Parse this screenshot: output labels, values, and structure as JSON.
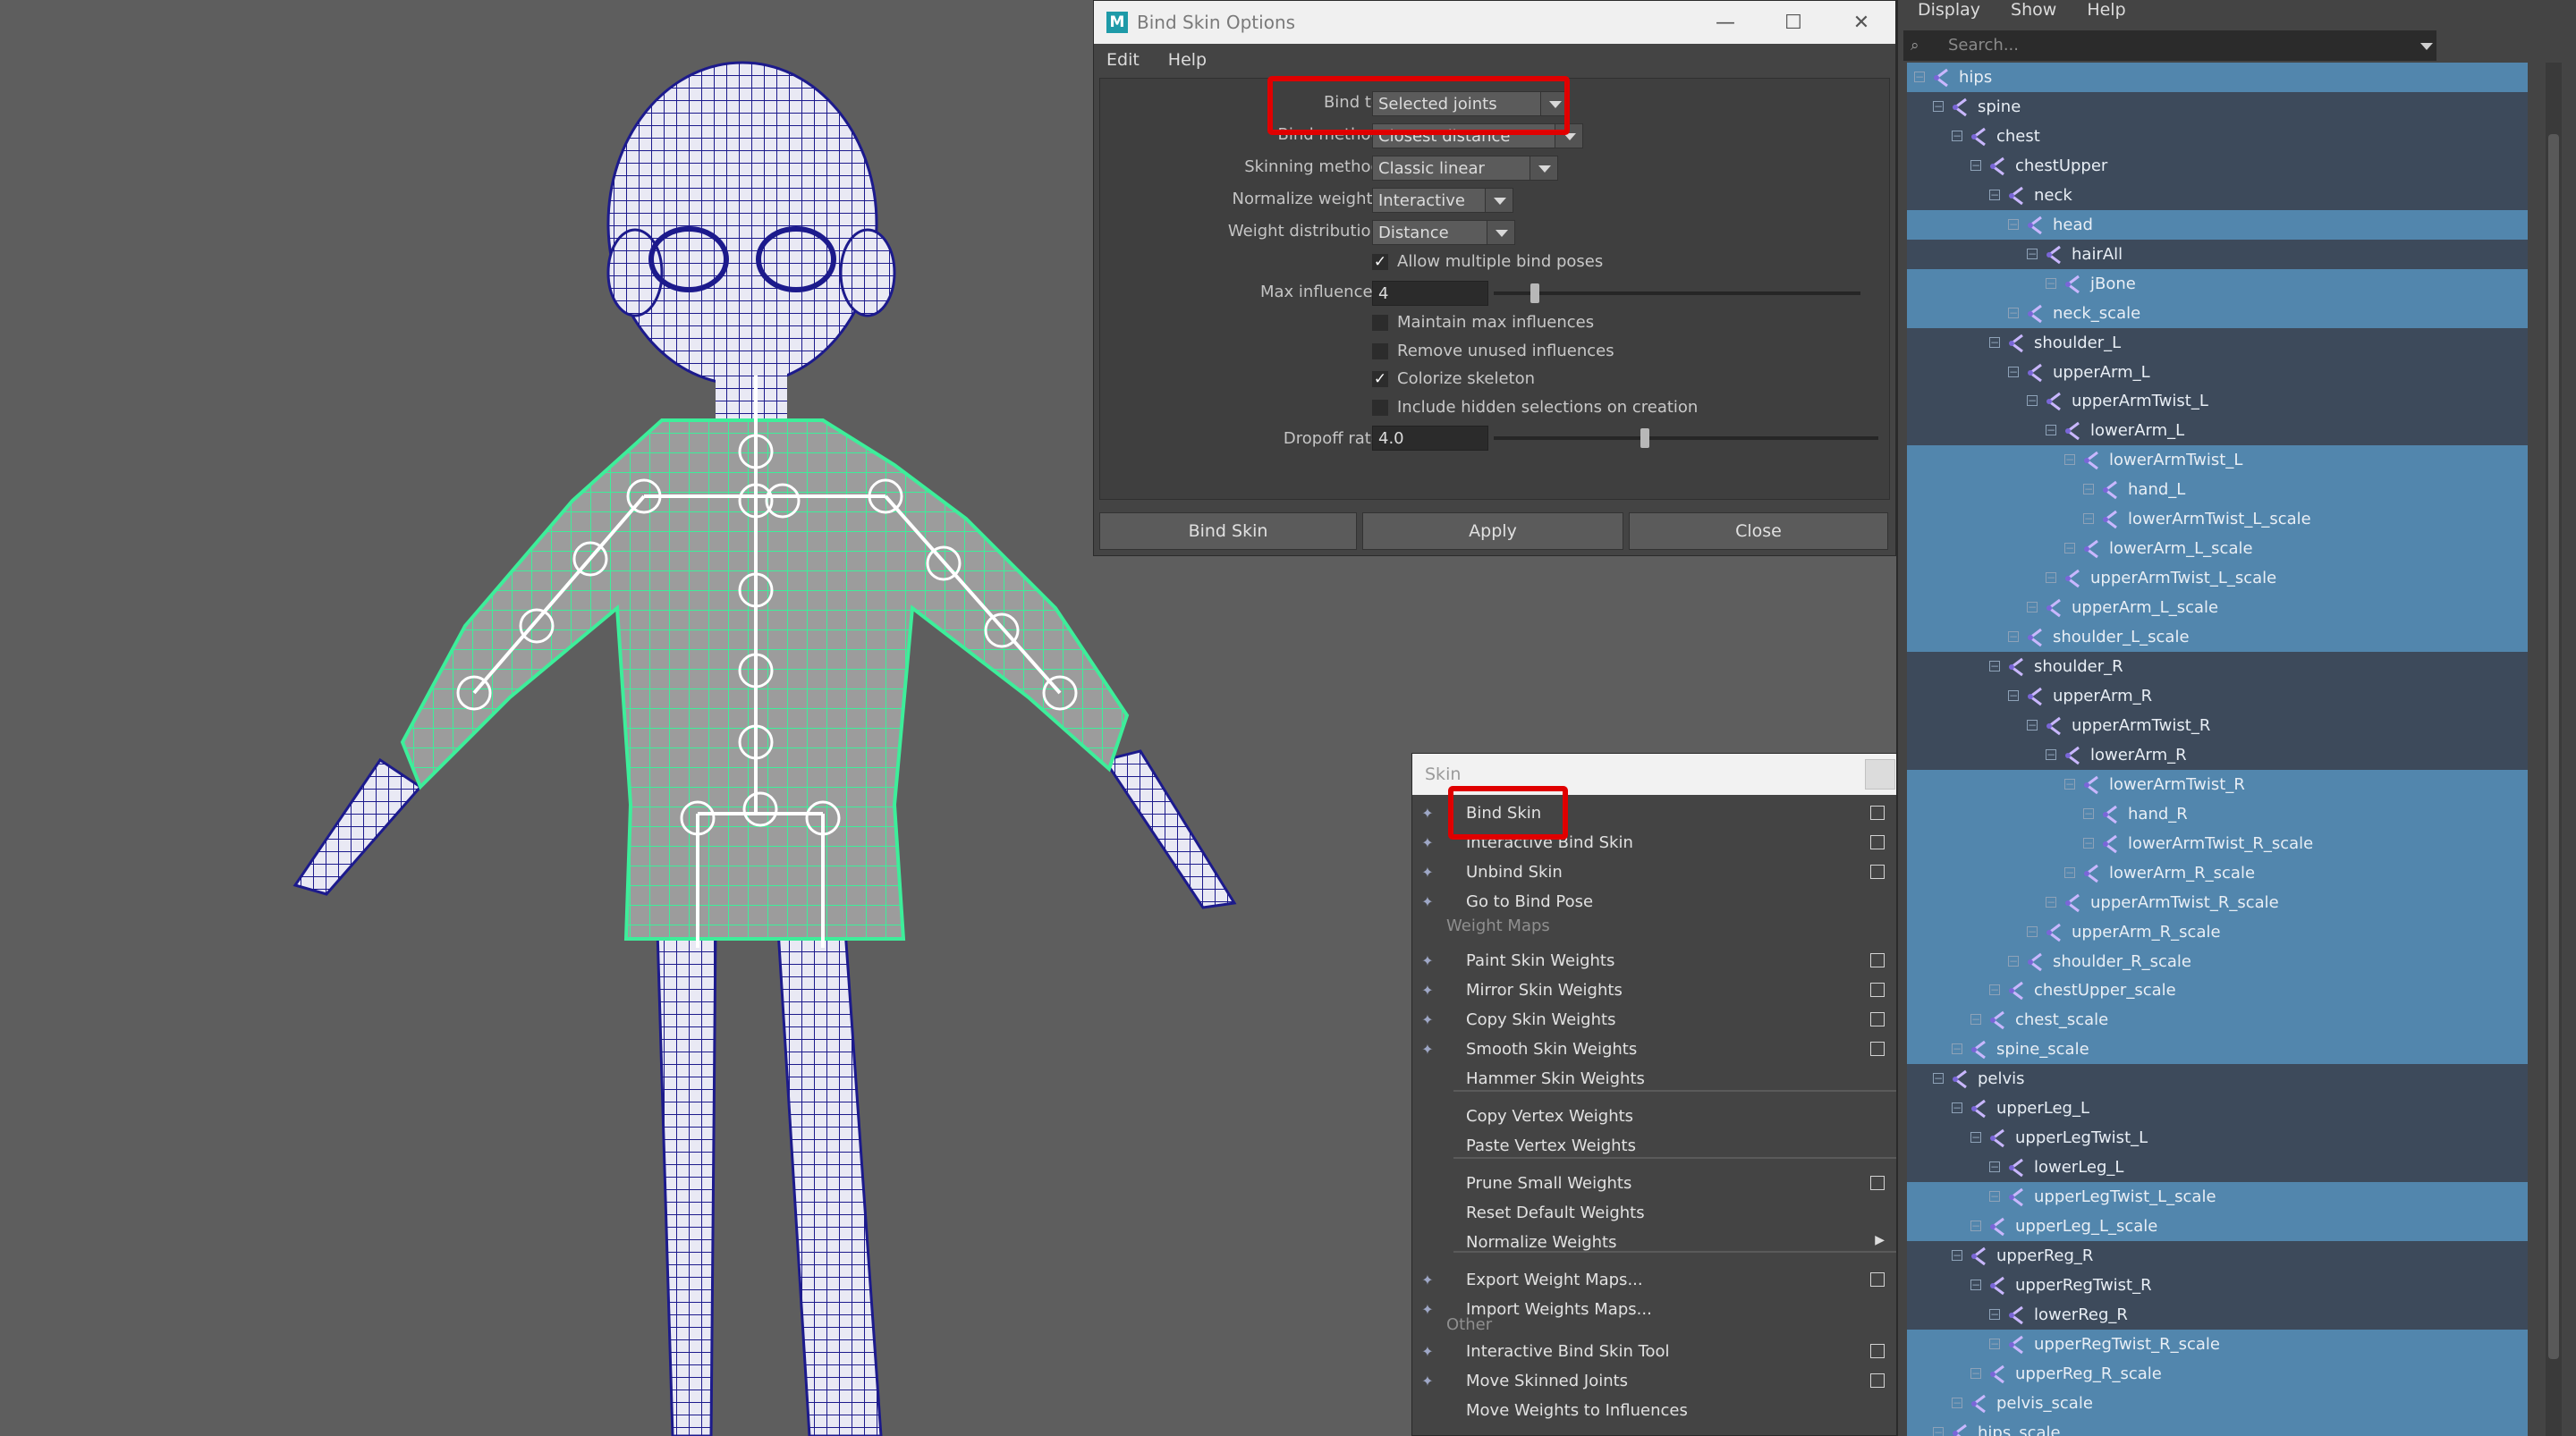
{
  "bind_skin_options": {
    "window_title": "Bind Skin Options",
    "app_icon_letter": "M",
    "menu": [
      "Edit",
      "Help"
    ],
    "options": {
      "bind_to": {
        "label": "Bind to:",
        "value": "Selected joints"
      },
      "bind_method": {
        "label": "Bind method:",
        "value": "Closest distance"
      },
      "skinning_method": {
        "label": "Skinning method:",
        "value": "Classic linear"
      },
      "normalize_weights": {
        "label": "Normalize weights:",
        "value": "Interactive"
      },
      "weight_distribution": {
        "label": "Weight distribution:",
        "value": "Distance"
      },
      "allow_multiple_bind_poses": {
        "label": "Allow multiple bind poses",
        "checked": true
      },
      "max_influences": {
        "label": "Max influences:",
        "value": "4"
      },
      "maintain_max_influences": {
        "label": "Maintain max influences",
        "checked": false
      },
      "remove_unused_influences": {
        "label": "Remove unused influences",
        "checked": false
      },
      "colorize_skeleton": {
        "label": "Colorize skeleton",
        "checked": true
      },
      "include_hidden": {
        "label": "Include hidden selections on creation",
        "checked": false
      },
      "dropoff_rate": {
        "label": "Dropoff rate:",
        "value": "4.0"
      }
    },
    "buttons": {
      "bind": "Bind Skin",
      "apply": "Apply",
      "close": "Close"
    }
  },
  "skin_menu": {
    "title": "Skin",
    "weight_maps_header": "Weight Maps",
    "other_header": "Other",
    "items": [
      {
        "label": "Bind Skin",
        "icon": "bind-skin-icon",
        "option_box": true
      },
      {
        "label": "Interactive Bind Skin",
        "icon": "interactive-bind-icon",
        "option_box": true
      },
      {
        "label": "Unbind Skin",
        "icon": "unbind-skin-icon",
        "option_box": true
      },
      {
        "label": "Go to Bind Pose",
        "icon": "bind-pose-icon",
        "option_box": false
      },
      {
        "label": "Paint Skin Weights",
        "icon": "paint-weights-icon",
        "option_box": true
      },
      {
        "label": "Mirror Skin Weights",
        "icon": "mirror-weights-icon",
        "option_box": true
      },
      {
        "label": "Copy Skin Weights",
        "icon": "copy-weights-icon",
        "option_box": true
      },
      {
        "label": "Smooth Skin Weights",
        "icon": "smooth-weights-icon",
        "option_box": true
      },
      {
        "label": "Hammer Skin Weights",
        "icon": "",
        "option_box": false
      },
      {
        "label": "Copy Vertex Weights",
        "icon": "",
        "option_box": false
      },
      {
        "label": "Paste Vertex Weights",
        "icon": "",
        "option_box": false
      },
      {
        "label": "Prune Small Weights",
        "icon": "",
        "option_box": true
      },
      {
        "label": "Reset Default Weights",
        "icon": "",
        "option_box": false
      },
      {
        "label": "Normalize Weights",
        "icon": "",
        "option_box": false,
        "submenu": true
      },
      {
        "label": "Export Weight Maps...",
        "icon": "export-weights-icon",
        "option_box": true
      },
      {
        "label": "Import Weights Maps...",
        "icon": "import-weights-icon",
        "option_box": false
      },
      {
        "label": "Interactive Bind Skin Tool",
        "icon": "bind-tool-icon",
        "option_box": true
      },
      {
        "label": "Move Skinned Joints",
        "icon": "move-joints-icon",
        "option_box": true
      },
      {
        "label": "Move Weights to Influences",
        "icon": "",
        "option_box": false
      }
    ]
  },
  "outliner": {
    "menu": [
      "Display",
      "Show",
      "Help"
    ],
    "search_placeholder": "Search...",
    "nodes": [
      {
        "name": "hips",
        "depth": 0,
        "selected": true
      },
      {
        "name": "spine",
        "depth": 1,
        "selected": false
      },
      {
        "name": "chest",
        "depth": 2,
        "selected": false
      },
      {
        "name": "chestUpper",
        "depth": 3,
        "selected": false
      },
      {
        "name": "neck",
        "depth": 4,
        "selected": false
      },
      {
        "name": "head",
        "depth": 5,
        "selected": true
      },
      {
        "name": "hairAll",
        "depth": 6,
        "selected": false
      },
      {
        "name": "jBone",
        "depth": 7,
        "selected": true
      },
      {
        "name": "neck_scale",
        "depth": 5,
        "selected": true
      },
      {
        "name": "shoulder_L",
        "depth": 4,
        "selected": false
      },
      {
        "name": "upperArm_L",
        "depth": 5,
        "selected": false
      },
      {
        "name": "upperArmTwist_L",
        "depth": 6,
        "selected": false
      },
      {
        "name": "lowerArm_L",
        "depth": 7,
        "selected": false
      },
      {
        "name": "lowerArmTwist_L",
        "depth": 8,
        "selected": true
      },
      {
        "name": "hand_L",
        "depth": 9,
        "selected": true
      },
      {
        "name": "lowerArmTwist_L_scale",
        "depth": 9,
        "selected": true
      },
      {
        "name": "lowerArm_L_scale",
        "depth": 8,
        "selected": true
      },
      {
        "name": "upperArmTwist_L_scale",
        "depth": 7,
        "selected": true
      },
      {
        "name": "upperArm_L_scale",
        "depth": 6,
        "selected": true
      },
      {
        "name": "shoulder_L_scale",
        "depth": 5,
        "selected": true
      },
      {
        "name": "shoulder_R",
        "depth": 4,
        "selected": false
      },
      {
        "name": "upperArm_R",
        "depth": 5,
        "selected": false
      },
      {
        "name": "upperArmTwist_R",
        "depth": 6,
        "selected": false
      },
      {
        "name": "lowerArm_R",
        "depth": 7,
        "selected": false
      },
      {
        "name": "lowerArmTwist_R",
        "depth": 8,
        "selected": true
      },
      {
        "name": "hand_R",
        "depth": 9,
        "selected": true
      },
      {
        "name": "lowerArmTwist_R_scale",
        "depth": 9,
        "selected": true
      },
      {
        "name": "lowerArm_R_scale",
        "depth": 8,
        "selected": true
      },
      {
        "name": "upperArmTwist_R_scale",
        "depth": 7,
        "selected": true
      },
      {
        "name": "upperArm_R_scale",
        "depth": 6,
        "selected": true
      },
      {
        "name": "shoulder_R_scale",
        "depth": 5,
        "selected": true
      },
      {
        "name": "chestUpper_scale",
        "depth": 4,
        "selected": true
      },
      {
        "name": "chest_scale",
        "depth": 3,
        "selected": true
      },
      {
        "name": "spine_scale",
        "depth": 2,
        "selected": true
      },
      {
        "name": "pelvis",
        "depth": 1,
        "selected": false
      },
      {
        "name": "upperLeg_L",
        "depth": 2,
        "selected": false
      },
      {
        "name": "upperLegTwist_L",
        "depth": 3,
        "selected": false
      },
      {
        "name": "lowerLeg_L",
        "depth": 4,
        "selected": false
      },
      {
        "name": "upperLegTwist_L_scale",
        "depth": 4,
        "selected": true
      },
      {
        "name": "upperLeg_L_scale",
        "depth": 3,
        "selected": true
      },
      {
        "name": "upperReg_R",
        "depth": 2,
        "selected": false
      },
      {
        "name": "upperRegTwist_R",
        "depth": 3,
        "selected": false
      },
      {
        "name": "lowerReg_R",
        "depth": 4,
        "selected": false
      },
      {
        "name": "upperRegTwist_R_scale",
        "depth": 4,
        "selected": true
      },
      {
        "name": "upperReg_R_scale",
        "depth": 3,
        "selected": true
      },
      {
        "name": "pelvis_scale",
        "depth": 2,
        "selected": true
      },
      {
        "name": "hips_scale",
        "depth": 1,
        "selected": true
      }
    ]
  }
}
